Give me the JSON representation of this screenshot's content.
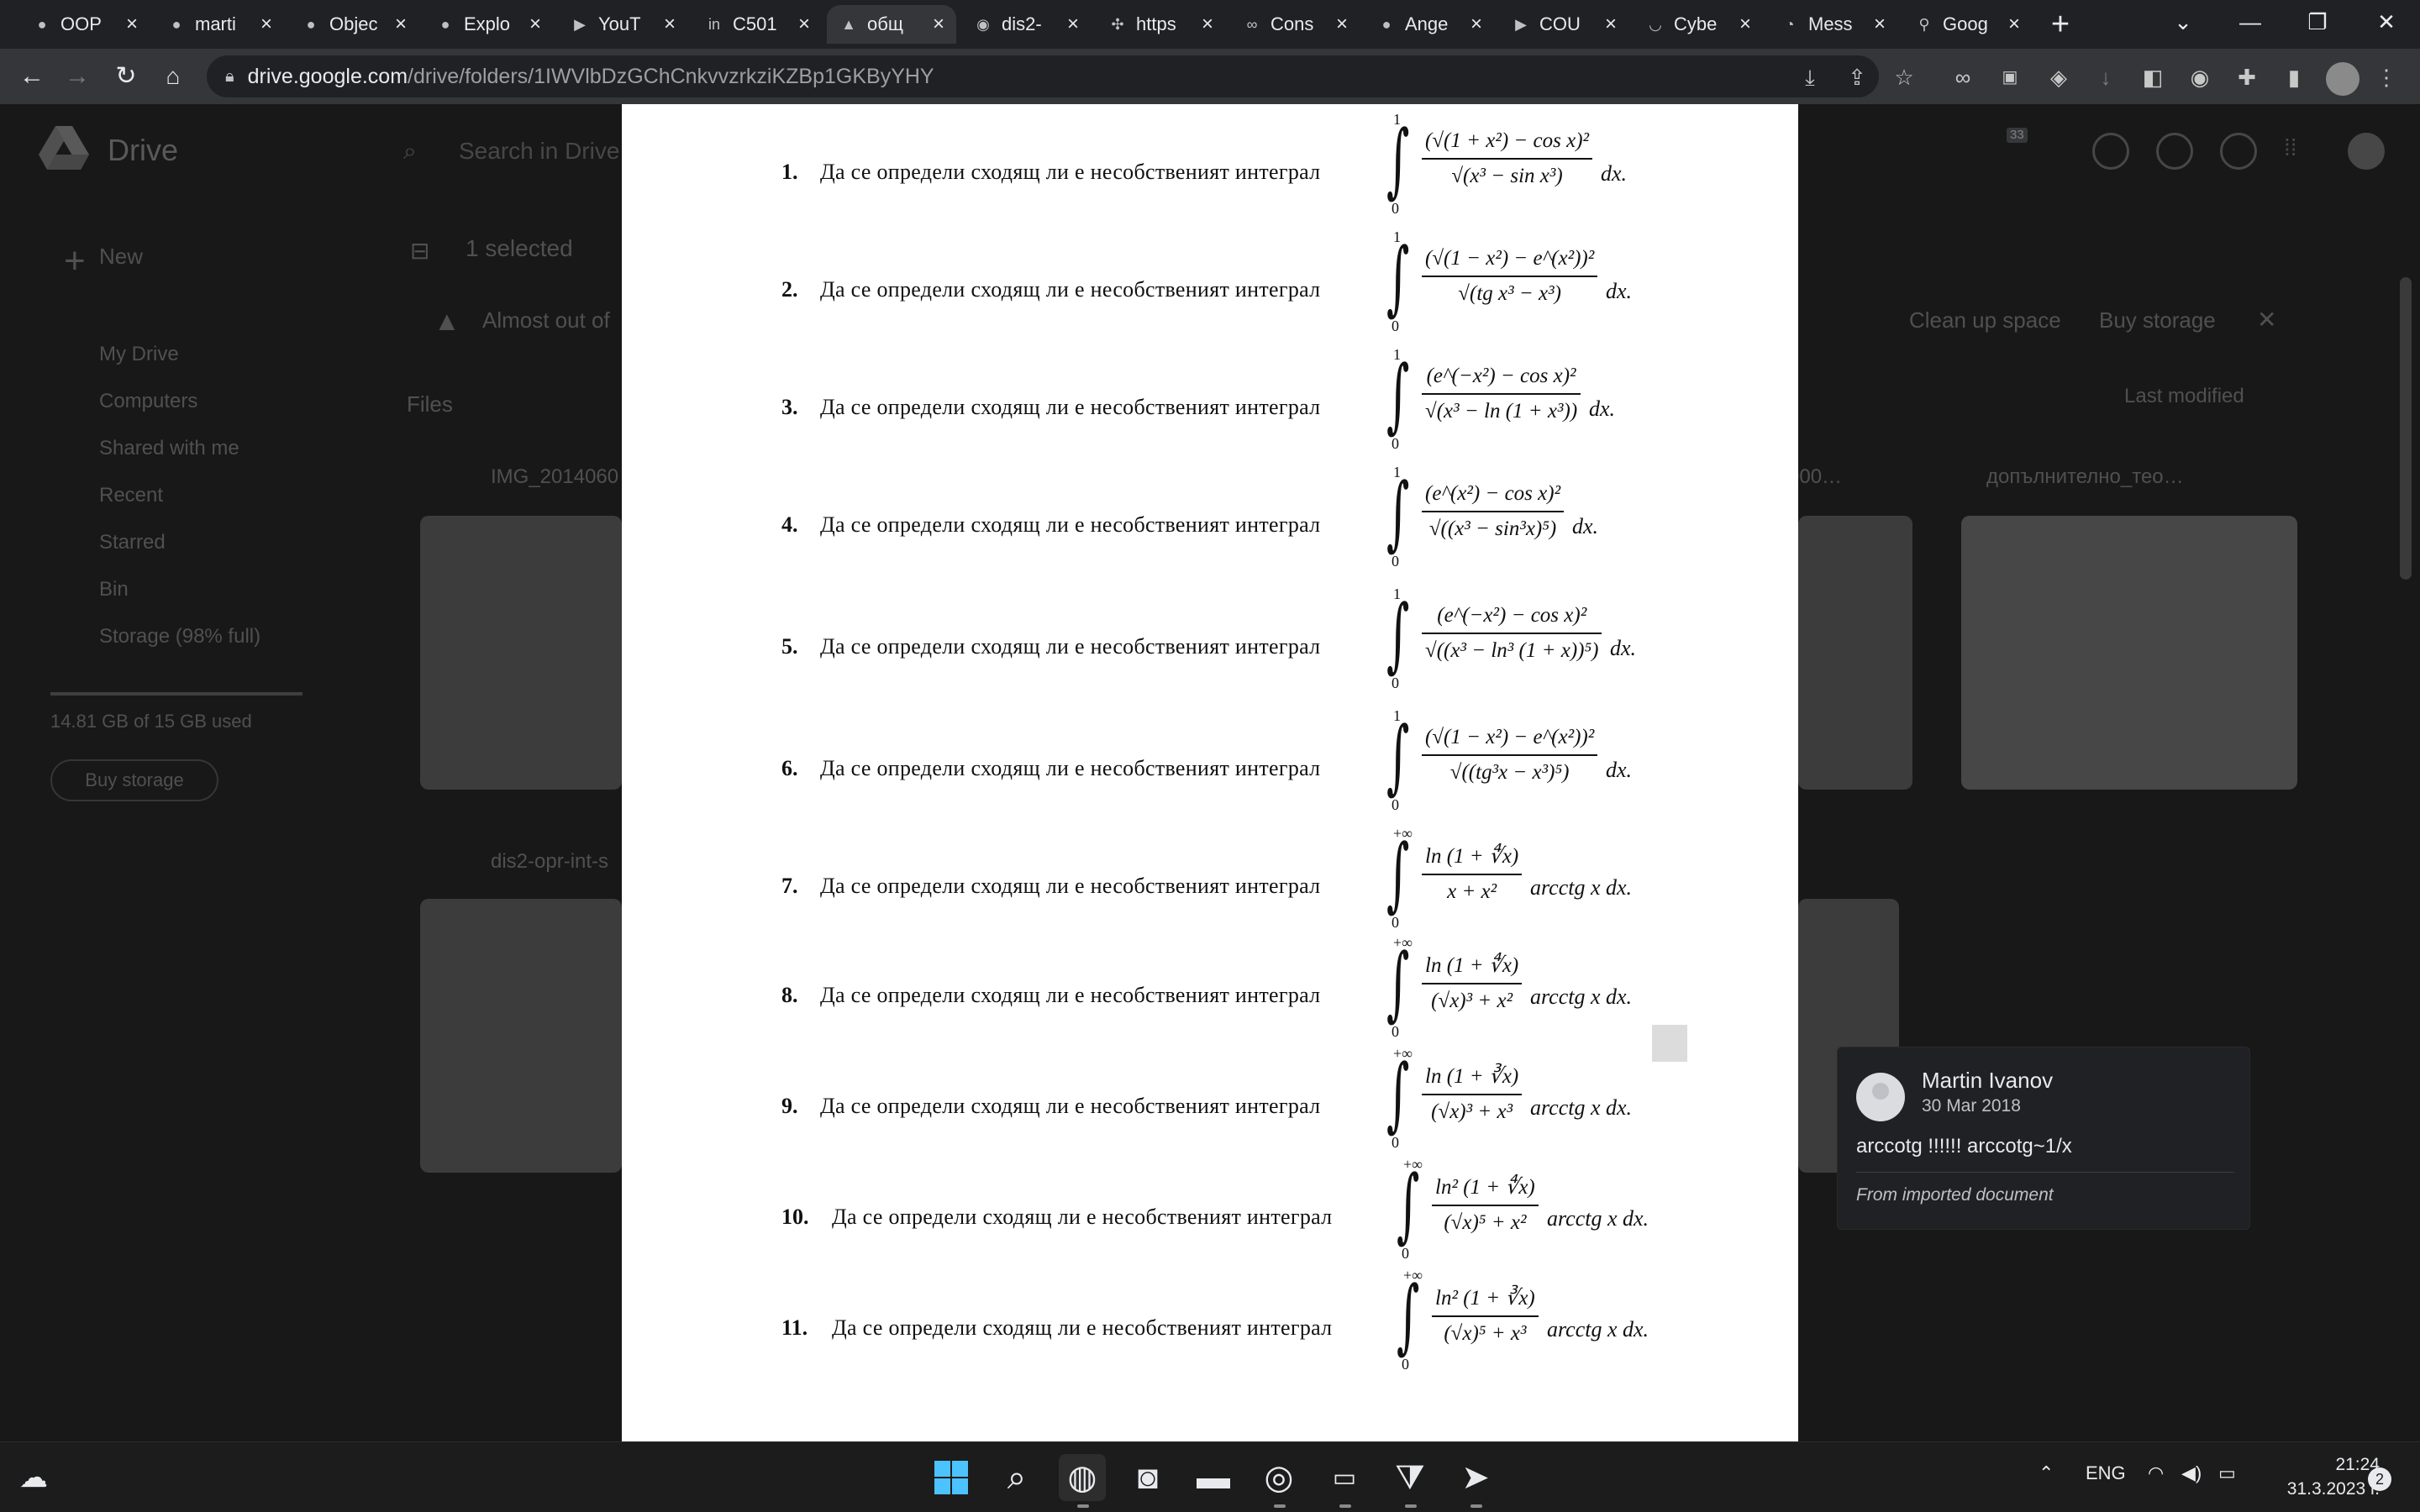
{
  "browser": {
    "tabs": [
      {
        "title": "OOP",
        "icon": "github-icon"
      },
      {
        "title": "marti",
        "icon": "github-icon"
      },
      {
        "title": "Objec",
        "icon": "github-icon"
      },
      {
        "title": "Explo",
        "icon": "github-icon"
      },
      {
        "title": "YouT",
        "icon": "youtube-icon"
      },
      {
        "title": "C501",
        "icon": "linkedin-icon"
      },
      {
        "title": "общ",
        "icon": "google-drive-icon",
        "active": true
      },
      {
        "title": "dis2-",
        "icon": "globe-icon"
      },
      {
        "title": "https",
        "icon": "extension-icon"
      },
      {
        "title": "Cons",
        "icon": "link-icon"
      },
      {
        "title": "Ange",
        "icon": "github-icon"
      },
      {
        "title": "COU",
        "icon": "youtube-icon"
      },
      {
        "title": "Cybe",
        "icon": "pocket-icon"
      },
      {
        "title": "Mess",
        "icon": "messenger-icon"
      },
      {
        "title": "Goog",
        "icon": "maps-pin-icon"
      }
    ],
    "url_host": "drive.google.com",
    "url_path": "/drive/folders/1IWVlbDzGChCnkvvzrkziKZBp1GKByYHY",
    "extension_badge": "33"
  },
  "drive": {
    "app_name": "Drive",
    "search_placeholder": "Search in Drive",
    "new_label": "New",
    "selected_label": "1 selected",
    "warning": "Almost out of",
    "files_label": "Files",
    "sort_label": "Last modified",
    "clean_label": "Clean up space",
    "buy_label": "Buy storage",
    "sidebar": [
      "My Drive",
      "Computers",
      "Shared with me",
      "Recent",
      "Starred",
      "Bin",
      "Storage (98% full)"
    ],
    "storage_used": "14.81 GB of 15 GB used",
    "buy_storage_button": "Buy storage",
    "file_names": [
      "IMG_2014060",
      "допълнително_тео…",
      "dis2-opr-int-s",
      "000…"
    ]
  },
  "document": {
    "problem_text": "Да се определи сходящ ли е несобственият интеграл",
    "problems": [
      {
        "num": "1.",
        "upper": "1",
        "lower": "0",
        "numerator": "(√(1 + x²) − cos x)²",
        "denominator": "√(x³ − sin x³)",
        "factor": "",
        "end": "dx."
      },
      {
        "num": "2.",
        "upper": "1",
        "lower": "0",
        "numerator": "(√(1 − x²) − e^(x²))²",
        "denominator": "√(tg x³ − x³)",
        "factor": "",
        "end": "dx."
      },
      {
        "num": "3.",
        "upper": "1",
        "lower": "0",
        "numerator": "(e^(−x²) − cos x)²",
        "denominator": "√(x³ − ln (1 + x³))",
        "factor": "",
        "end": "dx."
      },
      {
        "num": "4.",
        "upper": "1",
        "lower": "0",
        "numerator": "(e^(x²) − cos x)²",
        "denominator": "√((x³ − sin³x)⁵)",
        "factor": "",
        "end": "dx."
      },
      {
        "num": "5.",
        "upper": "1",
        "lower": "0",
        "numerator": "(e^(−x²) − cos x)²",
        "denominator": "√((x³ − ln³ (1 + x))⁵)",
        "factor": "",
        "end": "dx."
      },
      {
        "num": "6.",
        "upper": "1",
        "lower": "0",
        "numerator": "(√(1 − x²) − e^(x²))²",
        "denominator": "√((tg³x − x³)⁵)",
        "factor": "",
        "end": "dx."
      },
      {
        "num": "7.",
        "upper": "+∞",
        "lower": "0",
        "numerator": "ln (1 + ∜x)",
        "denominator": "x + x²",
        "factor": "arcctg x",
        "end": "dx."
      },
      {
        "num": "8.",
        "upper": "+∞",
        "lower": "0",
        "numerator": "ln (1 + ∜x)",
        "denominator": "(√x)³ + x²",
        "factor": "arcctg x",
        "end": "dx."
      },
      {
        "num": "9.",
        "upper": "+∞",
        "lower": "0",
        "numerator": "ln (1 + ∛x)",
        "denominator": "(√x)³ + x³",
        "factor": "arcctg x",
        "end": "dx."
      },
      {
        "num": "10.",
        "upper": "+∞",
        "lower": "0",
        "numerator": "ln² (1 + ∜x)",
        "denominator": "(√x)⁵ + x²",
        "factor": "arcctg x",
        "end": "dx."
      },
      {
        "num": "11.",
        "upper": "+∞",
        "lower": "0",
        "numerator": "ln² (1 + ∛x)",
        "denominator": "(√x)⁵ + x³",
        "factor": "arcctg x",
        "end": "dx."
      }
    ]
  },
  "comment": {
    "author": "Martin Ivanov",
    "date": "30 Mar 2018",
    "text": "arccotg !!!!!! arccotg~1/x",
    "source": "From imported document"
  },
  "taskbar": {
    "language": "ENG",
    "time": "21:24",
    "date": "31.3.2023 г.",
    "notifications": "2"
  }
}
